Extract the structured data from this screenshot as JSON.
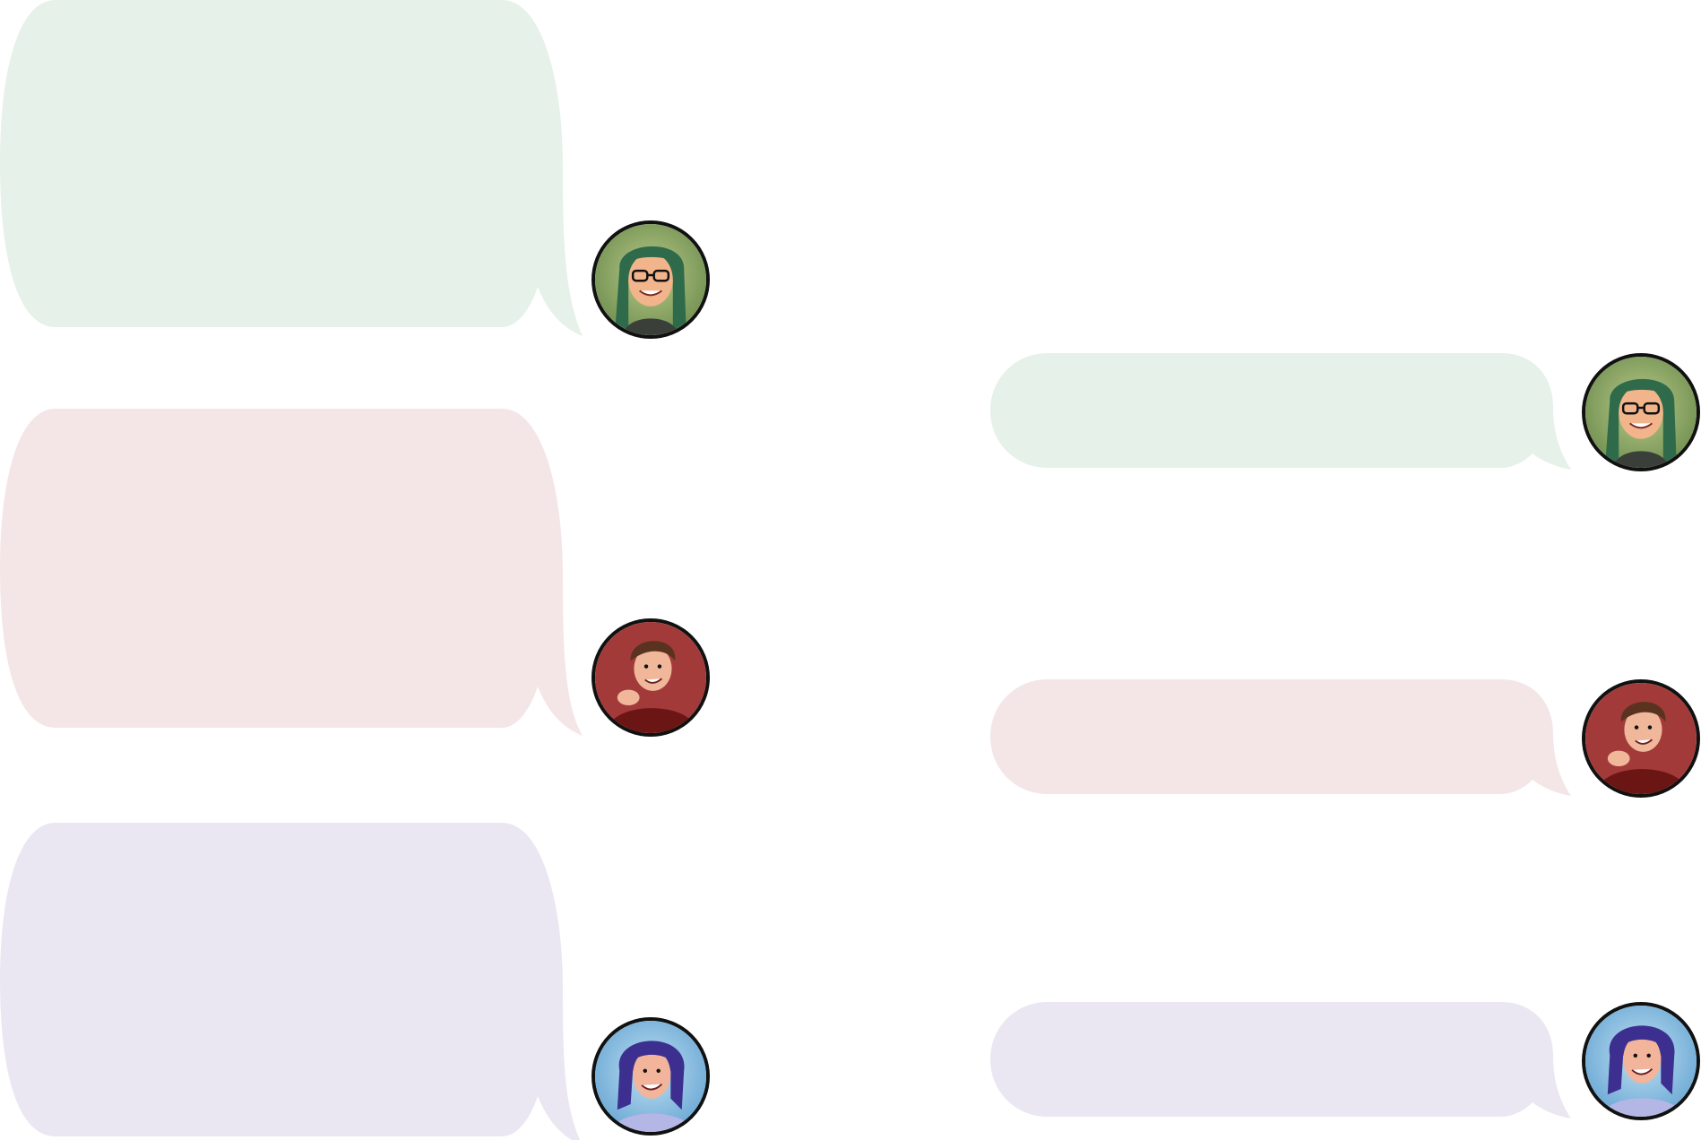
{
  "colors": {
    "green_bubble": "#e6f1e9",
    "red_bubble": "#f4e6e7",
    "purple_bubble": "#eae7f2",
    "avatar_border": "#111111"
  },
  "bubbles": [
    {
      "id": "large-green",
      "color": "green",
      "text": ""
    },
    {
      "id": "large-red",
      "color": "red",
      "text": ""
    },
    {
      "id": "large-purple",
      "color": "purple",
      "text": ""
    },
    {
      "id": "small-green",
      "color": "green",
      "text": ""
    },
    {
      "id": "small-red",
      "color": "red",
      "text": ""
    },
    {
      "id": "small-purple",
      "color": "purple",
      "text": ""
    }
  ],
  "avatars": [
    {
      "character": "green-haired-woman-with-glasses",
      "icon": "avatar-green-glasses-icon"
    },
    {
      "character": "brown-haired-man-red-shirt",
      "icon": "avatar-brown-hair-red-icon"
    },
    {
      "character": "purple-haired-man-blue",
      "icon": "avatar-purple-hair-blue-icon"
    }
  ]
}
